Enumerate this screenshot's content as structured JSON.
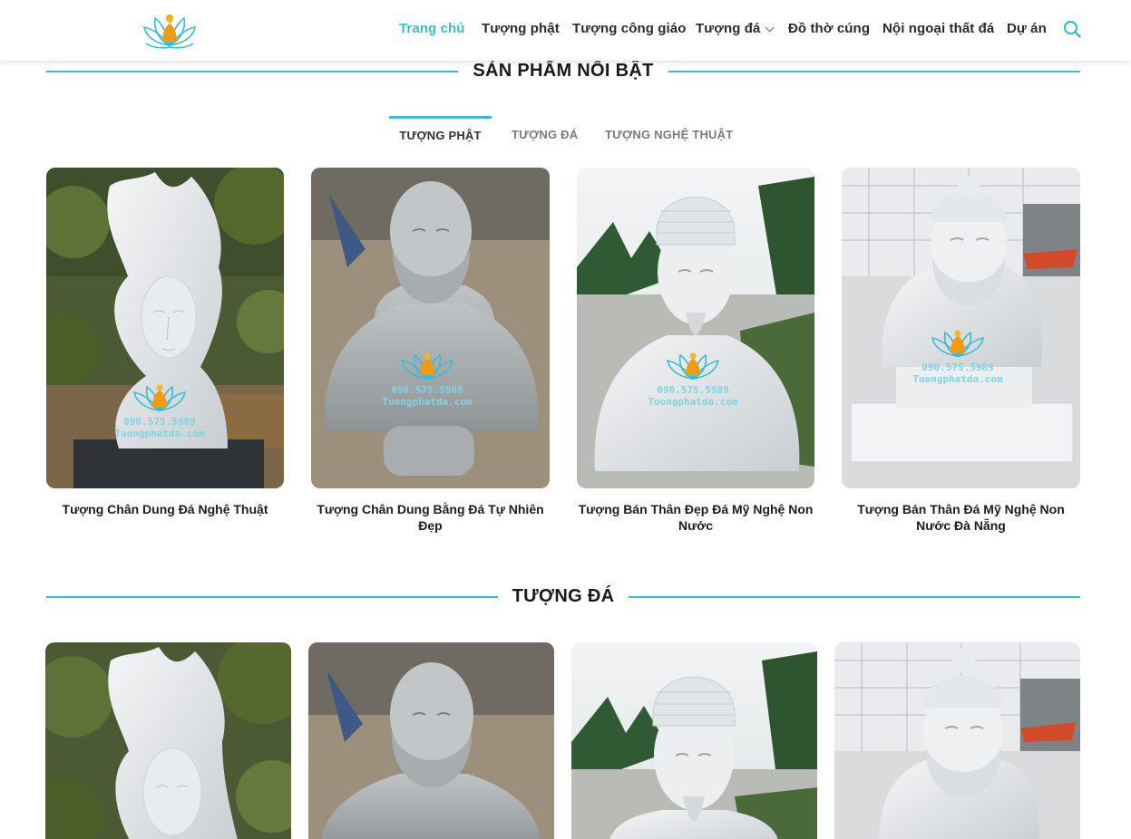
{
  "header": {
    "logo_alt": "Tuongphatda logo",
    "nav": [
      {
        "label": "Trang chủ",
        "active": true
      },
      {
        "label": "Tượng phật"
      },
      {
        "label": "Tượng công giáo"
      },
      {
        "label": "Tượng đá",
        "has_dropdown": true
      },
      {
        "label": "Đồ thờ cúng"
      },
      {
        "label": "Nội ngoại thất đá"
      },
      {
        "label": "Dự án"
      }
    ],
    "search_icon": "search-icon"
  },
  "featured": {
    "title": "SẢN PHẨM NỔI BẬT",
    "tabs": [
      {
        "label": "TƯỢNG PHẬT",
        "active": true
      },
      {
        "label": "TƯỢNG ĐÁ"
      },
      {
        "label": "TƯỢNG NGHỆ THUẬT"
      }
    ],
    "products": [
      {
        "name": "Tượng Chân Dung Đá Nghệ Thuật"
      },
      {
        "name": "Tượng Chân Dung Bằng Đá Tự Nhiên Đẹp"
      },
      {
        "name": "Tượng Bán Thân Đẹp Đá Mỹ Nghệ Non Nước"
      },
      {
        "name": "Tượng Bán Thân Đá Mỹ Nghệ Non Nước Đà Nẵng"
      }
    ]
  },
  "stone": {
    "title": "TƯỢNG ĐÁ"
  },
  "watermark": {
    "phone": "090.575.5989",
    "site": "Tuongphatda.com"
  },
  "colors": {
    "accent": "#39bcd3",
    "text": "#1d1d1d"
  }
}
